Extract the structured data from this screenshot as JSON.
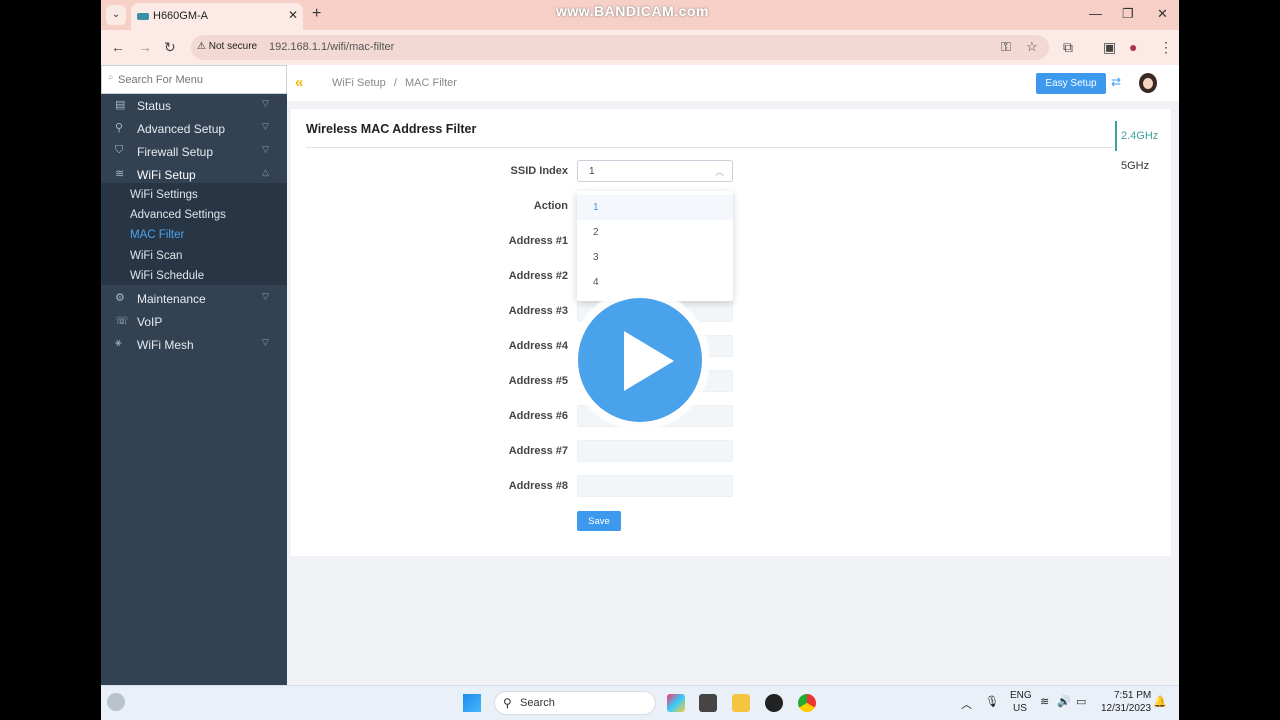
{
  "browser": {
    "tab_title": "H660GM-A",
    "tab_close": "✕",
    "new_tab": "+",
    "watermark": "www.BANDICAM.com",
    "not_secure": "Not secure",
    "url": "192.168.1.1/wifi/mac-filter",
    "back": "←",
    "forward": "→",
    "reload": "↻",
    "minimize": "—",
    "restore": "❐",
    "close": "✕"
  },
  "sidebar": {
    "search_placeholder": "Search For Menu",
    "items": [
      {
        "label": "Status",
        "icon": "status-icon"
      },
      {
        "label": "Advanced Setup",
        "icon": "wrench-icon"
      },
      {
        "label": "Firewall Setup",
        "icon": "shield-icon"
      },
      {
        "label": "WiFi Setup",
        "icon": "wifi-icon"
      },
      {
        "label": "Maintenance",
        "icon": "gear-icon"
      },
      {
        "label": "VoIP",
        "icon": "phone-icon"
      },
      {
        "label": "WiFi Mesh",
        "icon": "mesh-icon"
      }
    ],
    "submenu": [
      "WiFi Settings",
      "Advanced Settings",
      "MAC Filter",
      "WiFi Scan",
      "WiFi Schedule"
    ]
  },
  "header": {
    "breadcrumb_parent": "WiFi Setup",
    "breadcrumb_sep": "/",
    "breadcrumb_current": "MAC Filter",
    "easy_setup": "Easy Setup"
  },
  "panel": {
    "title": "Wireless MAC Address Filter",
    "bands": [
      "2.4GHz",
      "5GHz"
    ],
    "ssid_label": "SSID Index",
    "ssid_value": "1",
    "action_label": "Action",
    "addresses": [
      "Address #1",
      "Address #2",
      "Address #3",
      "Address #4",
      "Address #5",
      "Address #6",
      "Address #7",
      "Address #8"
    ],
    "dropdown_options": [
      "1",
      "2",
      "3",
      "4"
    ],
    "save": "Save"
  },
  "taskbar": {
    "search": "Search",
    "lang_top": "ENG",
    "lang_bottom": "US",
    "time": "7:51 PM",
    "date": "12/31/2023"
  },
  "colors": {
    "accent": "#3c99ee",
    "sidebar": "#334253",
    "active_band": "#3aa0a0",
    "collapse": "#f2b705"
  }
}
